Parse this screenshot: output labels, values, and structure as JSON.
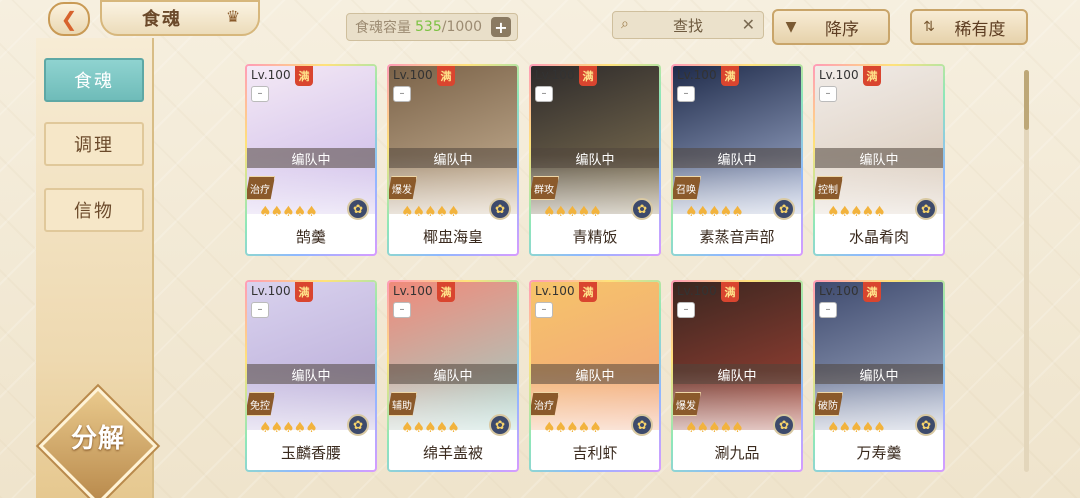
{
  "header": {
    "title": "食魂",
    "capacity_label": "食魂容量",
    "capacity_current": "535",
    "capacity_max": "/1000",
    "search_label": "查找",
    "sort_desc_label": "降序",
    "sort_rarity_label": "稀有度"
  },
  "sidebar": {
    "tabs": [
      {
        "label": "食魂",
        "active": true
      },
      {
        "label": "调理",
        "active": false
      },
      {
        "label": "信物",
        "active": false
      }
    ],
    "decompose_label": "分解"
  },
  "cards": [
    {
      "level": "Lv.100",
      "full": "满",
      "status": "编队中",
      "role": "治疗",
      "name": "鹄羹",
      "art": [
        "#f4e9f5",
        "#c9b7e8"
      ]
    },
    {
      "level": "Lv.100",
      "full": "满",
      "status": "编队中",
      "role": "爆发",
      "name": "椰盅海皇",
      "art": [
        "#7a6248",
        "#cdb79a"
      ]
    },
    {
      "level": "Lv.100",
      "full": "满",
      "status": "编队中",
      "role": "群攻",
      "name": "青精饭",
      "art": [
        "#2d2a2a",
        "#8a7a58"
      ]
    },
    {
      "level": "Lv.100",
      "full": "满",
      "status": "编队中",
      "role": "召唤",
      "name": "素蒸音声部",
      "art": [
        "#1f2b4a",
        "#a9b6d6"
      ]
    },
    {
      "level": "Lv.100",
      "full": "满",
      "status": "编队中",
      "role": "控制",
      "name": "水晶肴肉",
      "art": [
        "#f1ece8",
        "#d7c7b6"
      ]
    },
    {
      "level": "Lv.100",
      "full": "满",
      "status": "编队中",
      "role": "免控",
      "name": "玉麟香腰",
      "art": [
        "#d9d2ee",
        "#b6a8d6"
      ]
    },
    {
      "level": "Lv.100",
      "full": "满",
      "status": "编队中",
      "role": "辅助",
      "name": "绵羊盖被",
      "art": [
        "#f08a7a",
        "#9fd1c9"
      ]
    },
    {
      "level": "Lv.100",
      "full": "满",
      "status": "编队中",
      "role": "治疗",
      "name": "吉利虾",
      "art": [
        "#f6c46a",
        "#f1a27b"
      ]
    },
    {
      "level": "Lv.100",
      "full": "满",
      "status": "编队中",
      "role": "爆发",
      "name": "涮九品",
      "art": [
        "#3a2620",
        "#a74436"
      ]
    },
    {
      "level": "Lv.100",
      "full": "满",
      "status": "编队中",
      "role": "破防",
      "name": "万寿羹",
      "art": [
        "#3e4a6e",
        "#a7b1c9"
      ]
    }
  ]
}
